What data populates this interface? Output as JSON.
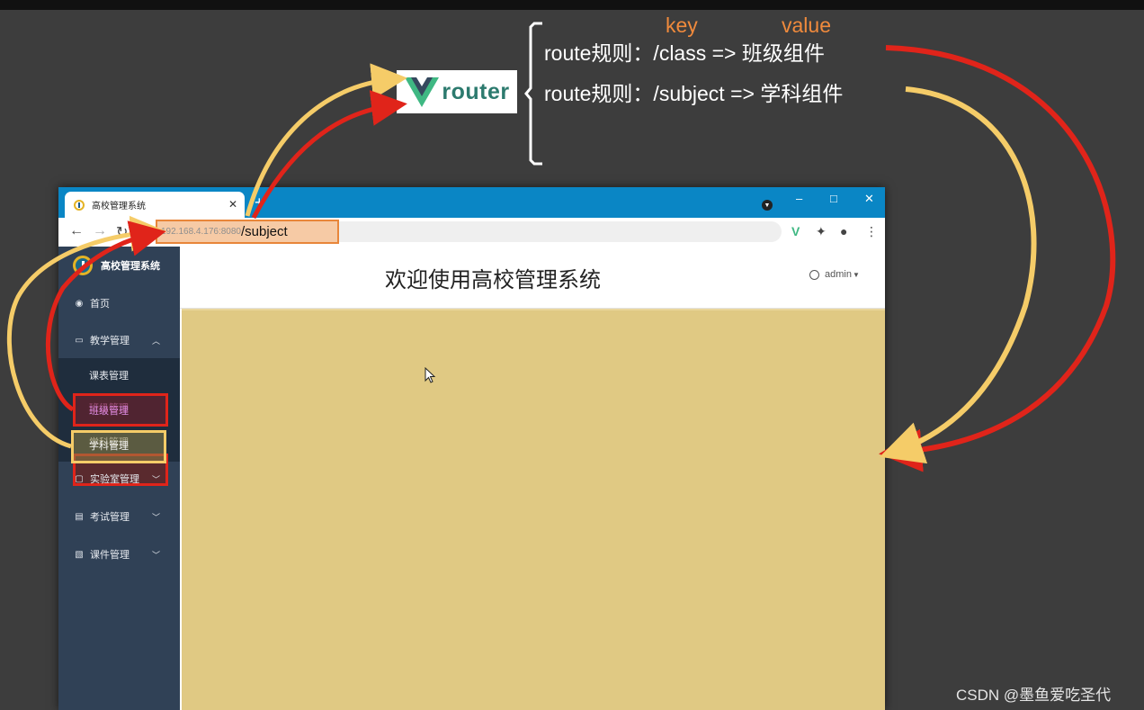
{
  "annotation": {
    "key_label": "key",
    "value_label": "value",
    "router_logo": "router",
    "rules": [
      {
        "text": "route规则：/class =>  班级组件"
      },
      {
        "text": "route规则：/subject => 学科组件"
      }
    ],
    "colors": {
      "red_arrow": "#e0241a",
      "yellow_arrow": "#f5cc68",
      "key_value": "#f08a3c"
    }
  },
  "browser": {
    "tab_title": "高校管理系统",
    "tab_close": "✕",
    "new_tab": "+",
    "url_host": "192.168.4.176:8080",
    "url_path": "/subject",
    "window_controls": {
      "minimize": "–",
      "maximize": "□",
      "close": "✕"
    }
  },
  "sidebar": {
    "brand": "高校管理系统",
    "items": [
      {
        "label": "首页",
        "icon": "dashboard-icon"
      },
      {
        "label": "教学管理",
        "icon": "monitor-icon",
        "expanded": true
      },
      {
        "label": "实验室管理",
        "icon": "lab-icon"
      },
      {
        "label": "考试管理",
        "icon": "exam-icon"
      },
      {
        "label": "课件管理",
        "icon": "courseware-icon"
      }
    ],
    "sub_items": [
      {
        "label": "课表管理"
      },
      {
        "label": "班级管理",
        "highlight": "red"
      },
      {
        "label": "学科管理",
        "highlight": "yellow"
      }
    ]
  },
  "header": {
    "title": "欢迎使用高校管理系统",
    "user": "admin"
  },
  "watermark": "CSDN @墨鱼爱吃圣代"
}
